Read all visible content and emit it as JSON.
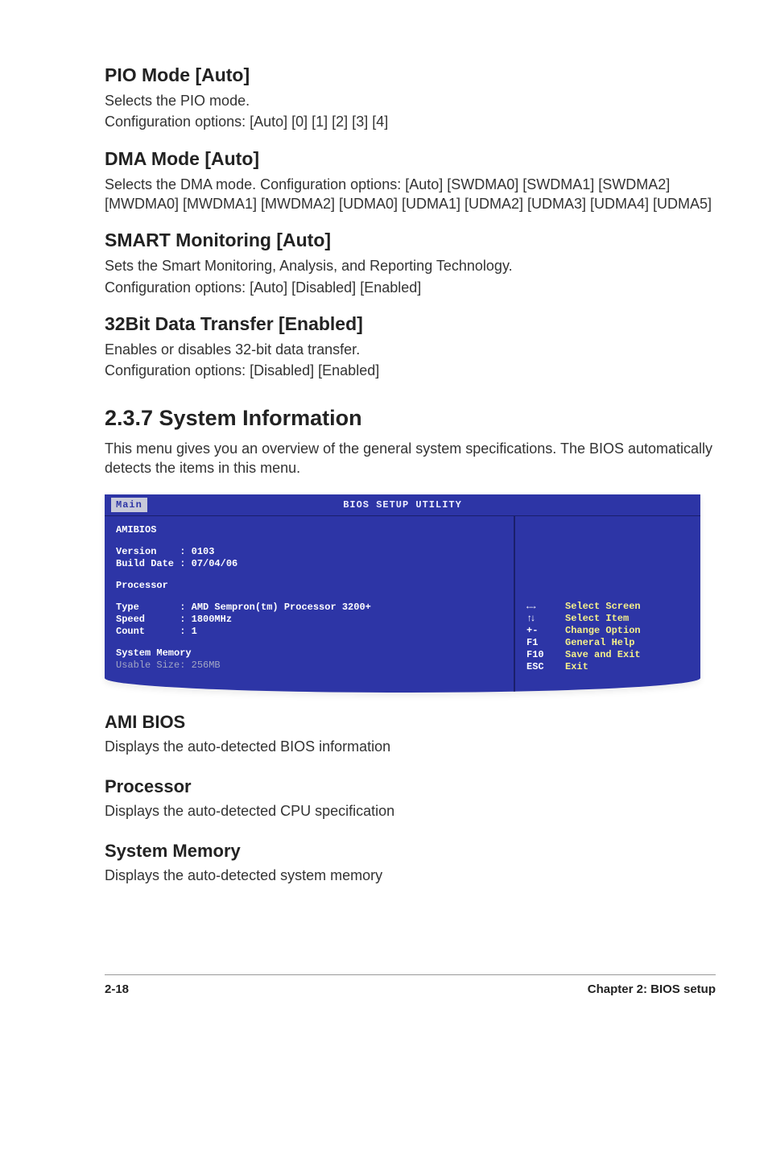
{
  "sections": {
    "pio": {
      "title": "PIO Mode [Auto]",
      "line1": "Selects the PIO mode.",
      "line2": "Configuration options: [Auto] [0] [1] [2] [3] [4]"
    },
    "dma": {
      "title": "DMA Mode [Auto]",
      "line1": "Selects the DMA mode. Configuration options: [Auto] [SWDMA0] [SWDMA1] [SWDMA2] [MWDMA0] [MWDMA1] [MWDMA2] [UDMA0] [UDMA1] [UDMA2] [UDMA3] [UDMA4] [UDMA5]"
    },
    "smart": {
      "title": "SMART Monitoring [Auto]",
      "line1": "Sets the Smart Monitoring, Analysis, and Reporting Technology.",
      "line2": "Configuration options: [Auto] [Disabled] [Enabled]"
    },
    "transfer": {
      "title": "32Bit Data Transfer [Enabled]",
      "line1": "Enables or disables 32-bit data transfer.",
      "line2": "Configuration options: [Disabled] [Enabled]"
    },
    "sysinfo": {
      "title": "2.3.7   System Information",
      "line1": "This menu gives you an overview of the general system specifications. The BIOS automatically detects the items in this menu."
    },
    "amibios": {
      "title": "AMI BIOS",
      "line1": "Displays the auto-detected BIOS information"
    },
    "processor": {
      "title": "Processor",
      "line1": "Displays the auto-detected CPU specification"
    },
    "sysmem": {
      "title": "System Memory",
      "line1": "Displays the auto-detected system memory"
    }
  },
  "bios": {
    "header": "BIOS SETUP UTILITY",
    "tab": "Main",
    "left": {
      "amibios_label": "AMIBIOS",
      "version_row": "Version    : 0103",
      "builddate_row": "Build Date : 07/04/06",
      "processor_label": "Processor",
      "type_row": "Type       : AMD Sempron(tm) Processor 3200+",
      "speed_row": "Speed      : 1800MHz",
      "count_row": "Count      : 1",
      "sysmem_label": "System Memory",
      "usable_row": "Usable Size: 256MB"
    },
    "help": [
      {
        "key_icon": "lr",
        "key": "",
        "act": "Select Screen"
      },
      {
        "key_icon": "ud",
        "key": "",
        "act": "Select Item"
      },
      {
        "key_icon": "",
        "key": "+-",
        "act": "Change Option"
      },
      {
        "key_icon": "",
        "key": "F1",
        "act": "General Help"
      },
      {
        "key_icon": "",
        "key": "F10",
        "act": "Save and Exit"
      },
      {
        "key_icon": "",
        "key": "ESC",
        "act": "Exit"
      }
    ]
  },
  "footer": {
    "left": "2-18",
    "right": "Chapter 2: BIOS setup"
  }
}
